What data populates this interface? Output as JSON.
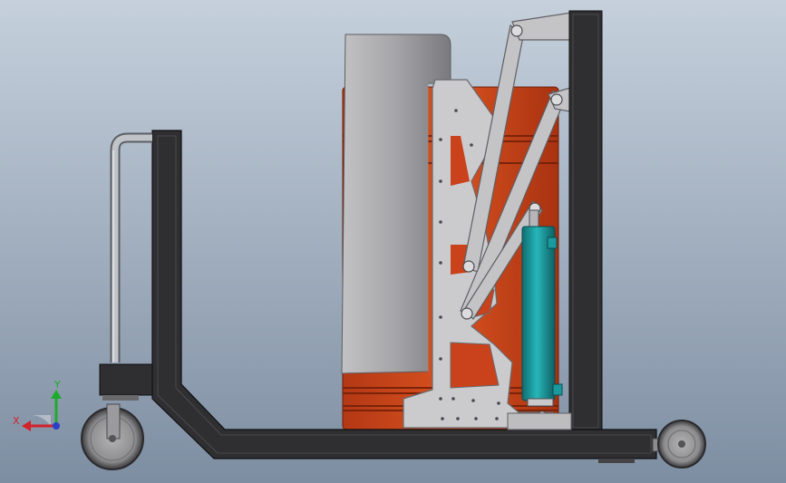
{
  "viewport": {
    "background_top": "#c5d0dc",
    "background_bottom": "#7e8ea2"
  },
  "colors": {
    "frame": "#2f2f31",
    "frame_edge": "#111113",
    "plate": "#c9c9cc",
    "plate_edge": "#6e6e72",
    "shield": "#a3a3a6",
    "drum": "#c9421b",
    "drum_dark": "#9c2e10",
    "cylinder": "#1a9a9e",
    "handle": "#b4b8bc",
    "wheel": "#8a8a8c",
    "axis_x": "#d3222a",
    "axis_y": "#1faa2e",
    "axis_z": "#2a3fcc"
  },
  "triad": {
    "x_label": "X",
    "y_label": "Y",
    "icon": "axis-triad-icon"
  }
}
